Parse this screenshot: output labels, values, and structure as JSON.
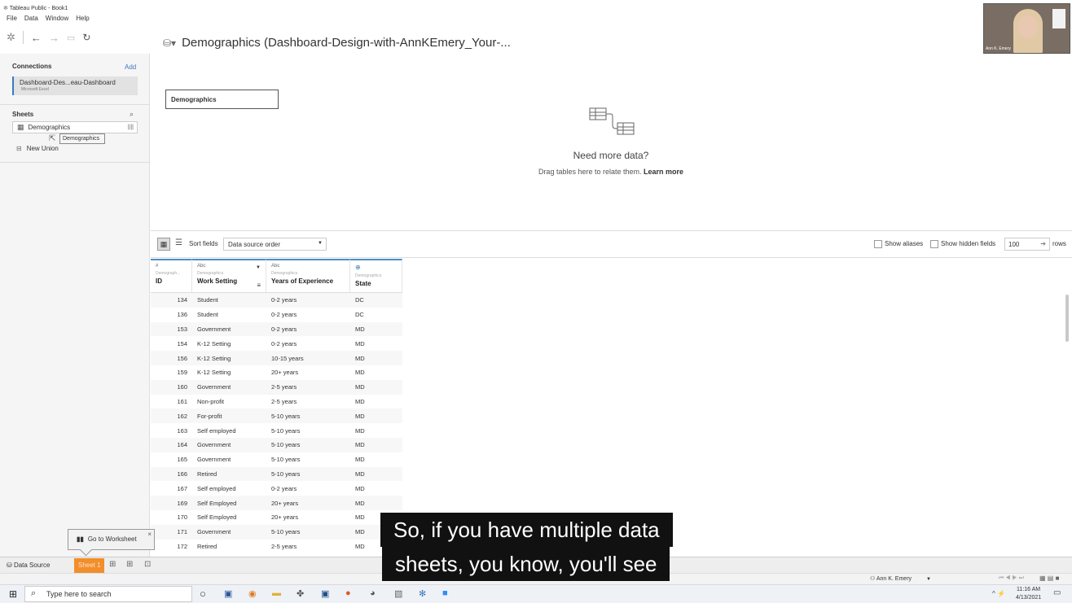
{
  "window": {
    "title": "Tableau Public - Book1"
  },
  "menu": [
    "File",
    "Data",
    "Window",
    "Help"
  ],
  "connections": {
    "title": "Connections",
    "add_label": "Add",
    "item_name": "Dashboard-Des...eau-Dashboard",
    "item_type": "Microsoft Excel"
  },
  "sheets": {
    "title": "Sheets",
    "item": "Demographics",
    "tooltip": "Demographics",
    "union": "New Union"
  },
  "canvas": {
    "title": "Demographics (Dashboard-Design-with-AnnKEmery_Your-...",
    "table_name": "Demographics",
    "empty_heading": "Need more data?",
    "empty_text": "Drag tables here to relate them.",
    "learn_more": "Learn more"
  },
  "grid_toolbar": {
    "sort_label": "Sort fields",
    "sort_value": "Data source order",
    "show_aliases": "Show aliases",
    "show_hidden": "Show hidden fields",
    "rows_value": "100",
    "rows_label": "rows"
  },
  "columns": [
    {
      "type": "#",
      "source": "Demograph...",
      "name": "ID"
    },
    {
      "type": "Abc",
      "source": "Demographics",
      "name": "Work Setting"
    },
    {
      "type": "Abc",
      "source": "Demographics",
      "name": "Years of Experience"
    },
    {
      "type": "globe",
      "source": "Demographics",
      "name": "State"
    }
  ],
  "rows": [
    [
      "134",
      "Student",
      "0-2 years",
      "DC"
    ],
    [
      "136",
      "Student",
      "0-2 years",
      "DC"
    ],
    [
      "153",
      "Government",
      "0-2 years",
      "MD"
    ],
    [
      "154",
      "K-12 Setting",
      "0-2 years",
      "MD"
    ],
    [
      "156",
      "K-12 Setting",
      "10-15 years",
      "MD"
    ],
    [
      "159",
      "K-12 Setting",
      "20+ years",
      "MD"
    ],
    [
      "160",
      "Government",
      "2-5 years",
      "MD"
    ],
    [
      "161",
      "Non-profit",
      "2-5 years",
      "MD"
    ],
    [
      "162",
      "For-profit",
      "5-10 years",
      "MD"
    ],
    [
      "163",
      "Self employed",
      "5-10 years",
      "MD"
    ],
    [
      "164",
      "Government",
      "5-10 years",
      "MD"
    ],
    [
      "165",
      "Government",
      "5-10 years",
      "MD"
    ],
    [
      "166",
      "Retired",
      "5-10 years",
      "MD"
    ],
    [
      "167",
      "Self employed",
      "0-2 years",
      "MD"
    ],
    [
      "169",
      "Self Employed",
      "20+ years",
      "MD"
    ],
    [
      "170",
      "Self Employed",
      "20+ years",
      "MD"
    ],
    [
      "171",
      "Government",
      "5-10 years",
      "MD"
    ],
    [
      "172",
      "Retired",
      "2-5 years",
      "MD"
    ]
  ],
  "bottom": {
    "data_source": "Data Source",
    "sheet_tab": "Sheet 1",
    "goto_tip": "Go to Worksheet",
    "user": "Ann K. Emery"
  },
  "caption": [
    "So, if you have multiple data",
    "sheets, you know, you'll see"
  ],
  "taskbar": {
    "search_placeholder": "Type here to search",
    "time": "11:16 AM",
    "date": "4/13/2021"
  },
  "webcam": {
    "label": "Ann K. Emery"
  },
  "colors": {
    "accent": "#3a7bbf",
    "sheet_tab": "#f28e2b",
    "header_rule": "#4a90c4"
  }
}
